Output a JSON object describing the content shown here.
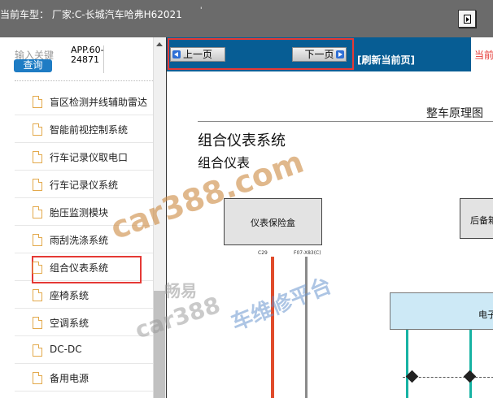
{
  "header": {
    "title": "当前车型： 厂家:C-长城汽车哈弗H62021",
    "dot": "'"
  },
  "left_panel": {
    "search_label": "输入关键",
    "search_button": "查询",
    "app_code": "APP.60-\n24871",
    "tree_items": [
      {
        "label": "盲区检测并线辅助雷达",
        "selected": false
      },
      {
        "label": "智能前视控制系统",
        "selected": false
      },
      {
        "label": "行车记录仪取电口",
        "selected": false
      },
      {
        "label": "行车记录仪系统",
        "selected": false
      },
      {
        "label": "胎压监测模块",
        "selected": false
      },
      {
        "label": "雨刮洗涤系统",
        "selected": false
      },
      {
        "label": "组合仪表系统",
        "selected": true
      },
      {
        "label": "座椅系统",
        "selected": false
      },
      {
        "label": "空调系统",
        "selected": false
      },
      {
        "label": "DC-DC",
        "selected": false
      },
      {
        "label": "备用电源",
        "selected": false
      }
    ]
  },
  "toolbar": {
    "prev_label": "上一页",
    "next_label": "下一页",
    "refresh_label": "[刷新当前页]",
    "current_page_label": "当前"
  },
  "document": {
    "header": "整车原理图",
    "title": "组合仪表系统",
    "subtitle": "组合仪表",
    "box_fuse": "仪表保险盒",
    "pin_left": "C29",
    "pin_right": "F07-X83(C)",
    "box_rear": "后备箱",
    "box_elec": "电子"
  },
  "watermarks": [
    "car388.com",
    "畅易",
    "car388",
    "车维修平台"
  ],
  "colors": {
    "toolbar_bg": "#075d94",
    "highlight_red": "#e53935",
    "search_button_bg": "#1e7cc4",
    "header_bg": "#6b6b6b"
  }
}
